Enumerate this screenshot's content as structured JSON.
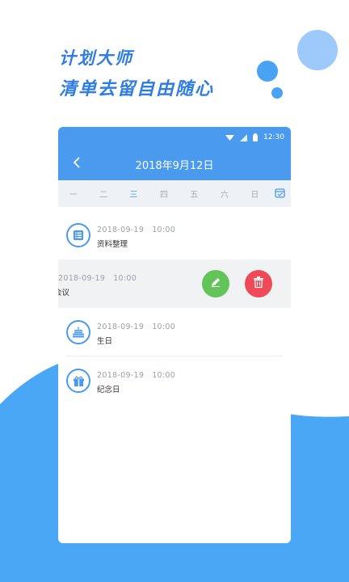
{
  "headline": {
    "line1": "计划大师",
    "line2": "清单去留自由随心"
  },
  "status_bar": {
    "time": "12:30",
    "icons": [
      "wifi-icon",
      "signal-icon",
      "battery-icon"
    ]
  },
  "nav": {
    "title": "2018年9月12日",
    "back_icon": "chevron-left-icon"
  },
  "week": {
    "days": [
      "一",
      "二",
      "三",
      "四",
      "五",
      "六",
      "日"
    ],
    "active_day": "三",
    "calendar_icon": "calendar-check-icon"
  },
  "items": [
    {
      "date": "2018-09-19",
      "time": "10:00",
      "title": "资料整理",
      "icon": "document-list-icon"
    },
    {
      "date": "2018-09-19",
      "time": "10:00",
      "title": "会议",
      "icon": "meeting-icon",
      "swiped": true
    },
    {
      "date": "2018-09-19",
      "time": "10:00",
      "title": "生日",
      "icon": "birthday-cake-icon"
    },
    {
      "date": "2018-09-19",
      "time": "10:00",
      "title": "纪念日",
      "icon": "gift-icon"
    }
  ],
  "actions": {
    "edit_icon": "pencil-icon",
    "delete_icon": "trash-icon"
  },
  "colors": {
    "primary": "#4a9af0",
    "headline": "#2f7de3",
    "edit": "#63c45a",
    "delete": "#ee4a58",
    "week_bg": "#eef1f5"
  }
}
